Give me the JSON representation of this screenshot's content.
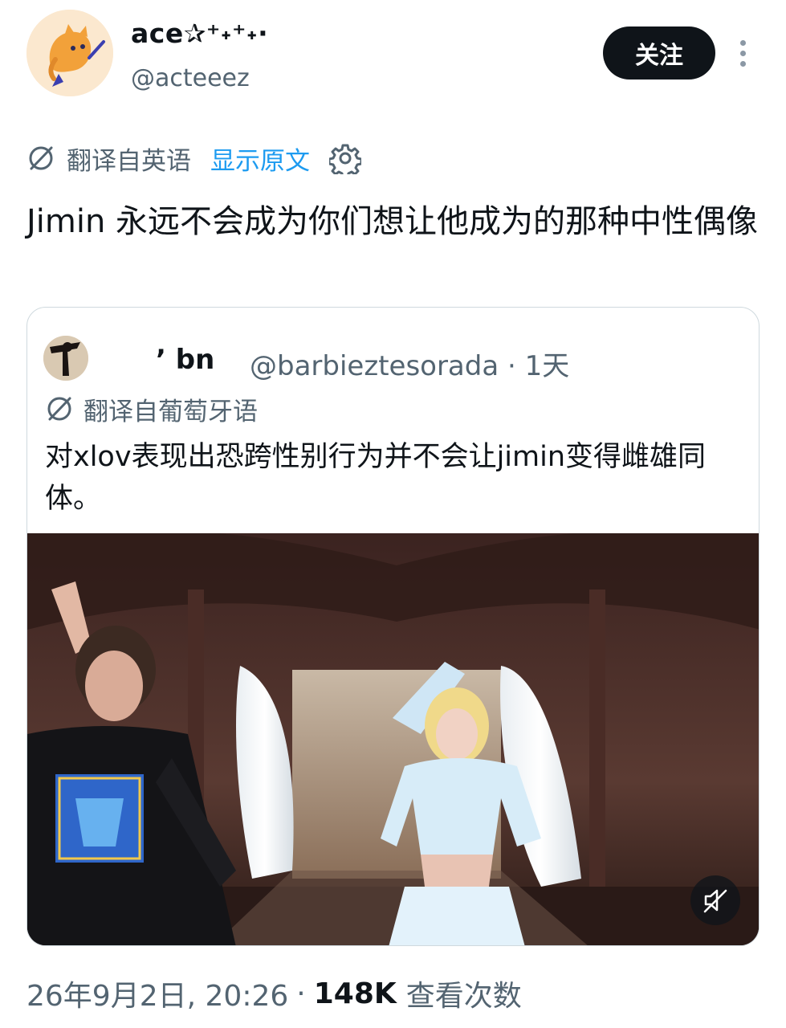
{
  "author": {
    "display_name": "ace✰⁺˖⁺˖·",
    "handle": "@acteeez"
  },
  "header": {
    "follow_label": "关注",
    "more_icon": "more-vertical-icon"
  },
  "translation": {
    "label": "翻译自英语",
    "show_original": "显示原文",
    "icon": "translate-icon",
    "settings_icon": "gear-icon"
  },
  "tweet": {
    "text": "Jimin 永远不会成为你们想让他成为的那种中性偶像"
  },
  "quote": {
    "display_name": "’ bn",
    "meta": "@barbieztesorada · 1天",
    "translation_label": "翻译自葡萄牙语",
    "text": "对xlov表现出恐跨性别行为并不会让jimin变得雌雄同体。",
    "mute_icon": "mute-icon"
  },
  "footer": {
    "timestamp": "26年9月2日, 20:26",
    "separator": "·",
    "views_count": "148K",
    "views_label": "查看次数"
  },
  "colors": {
    "accent": "#1d9bf0",
    "text": "#0f1419",
    "secondary": "#536471",
    "border": "#cfd9de"
  }
}
